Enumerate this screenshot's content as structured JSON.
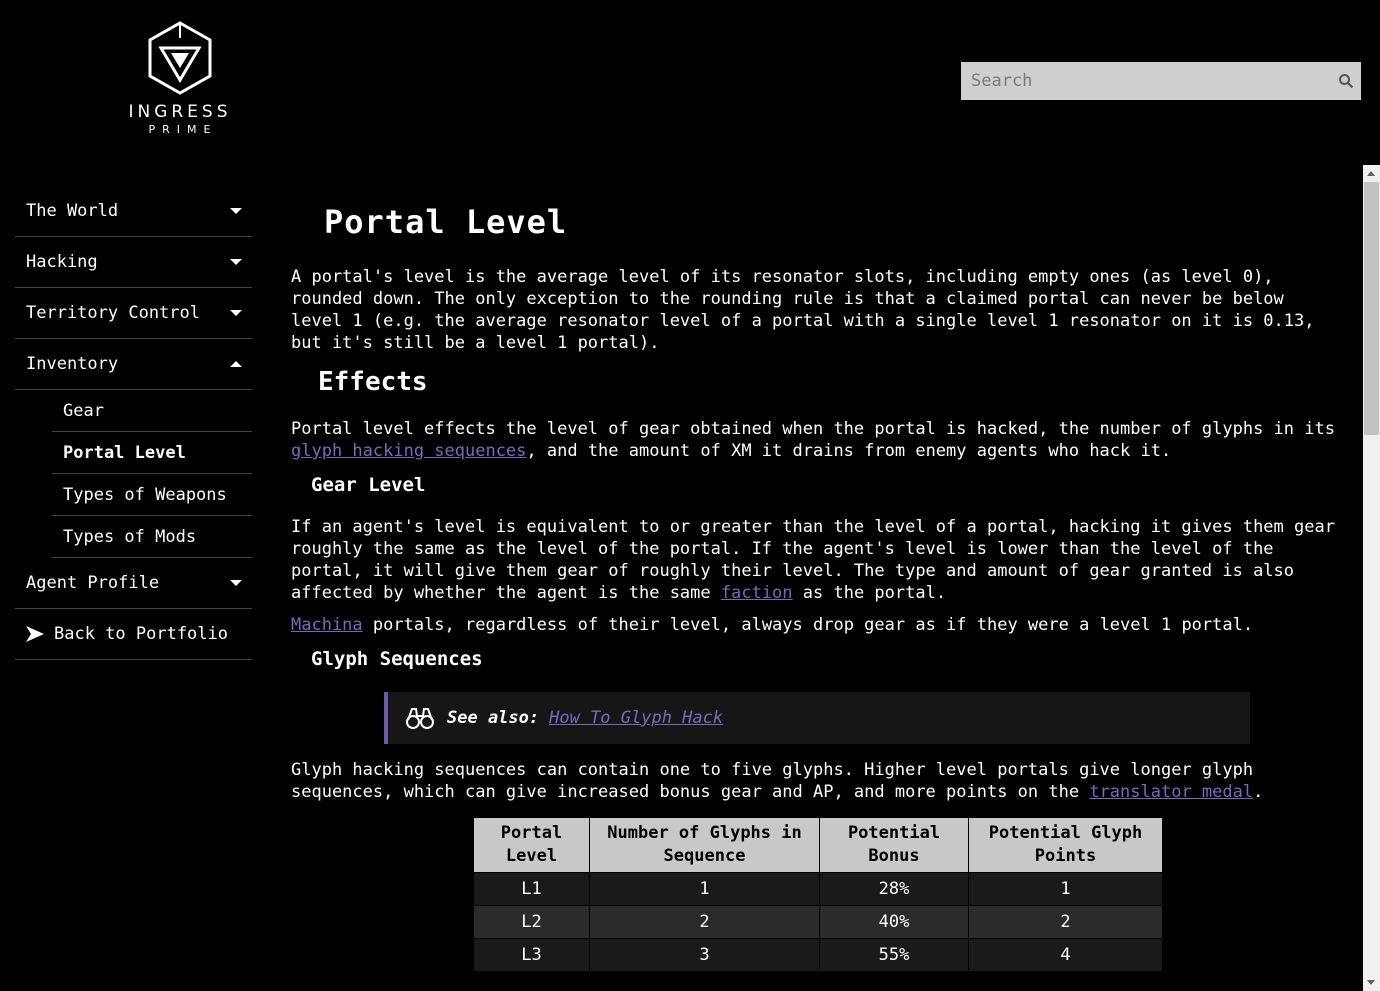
{
  "logo": {
    "word": "INGRESS",
    "sub": "PRIME"
  },
  "search": {
    "placeholder": "Search",
    "icon": "search-icon"
  },
  "sidebar": {
    "items": [
      {
        "label": "The World",
        "state": "collapsed"
      },
      {
        "label": "Hacking",
        "state": "collapsed"
      },
      {
        "label": "Territory Control",
        "state": "collapsed"
      },
      {
        "label": "Inventory",
        "state": "expanded",
        "children": [
          "Gear",
          "Portal Level",
          "Types of Weapons",
          "Types of Mods"
        ],
        "active_child": "Portal Level"
      },
      {
        "label": "Agent Profile",
        "state": "collapsed"
      }
    ],
    "back": {
      "icon": "arrow-right-icon",
      "label": "Back to Portfolio"
    }
  },
  "article": {
    "title": "Portal Level",
    "intro": "A portal's level is the average level of its resonator slots, including empty ones (as level 0), rounded down. The only exception to the rounding rule is that a claimed portal can never be below level 1 (e.g. the average resonator level of a portal with a single level 1 resonator on it is 0.13, but it's still be a level 1 portal).",
    "effects_heading": "Effects",
    "effects_p1_before": "Portal level effects the level of gear obtained when the portal is hacked, the number of glyphs in its ",
    "effects_p1_link": "glyph hacking sequences",
    "effects_p1_after": ", and the amount of XM it drains from enemy agents who hack it.",
    "gear_heading": "Gear Level",
    "gear_p1_before": "If an agent's level is equivalent to or greater than the level of a portal, hacking it gives them gear roughly the same as the level of the portal. If the agent's level is lower than the level of the portal, it will give them gear of roughly their level. The type and amount of gear granted is also affected by whether the agent is the same ",
    "gear_p1_link": "faction",
    "gear_p1_after": " as the portal.",
    "gear_p2_link": "Machina",
    "gear_p2_after": " portals, regardless of their level, always drop gear as if they were a level 1 portal.",
    "glyph_heading": "Glyph Sequences",
    "callout": {
      "icon": "binoculars-icon",
      "label": "See also:",
      "link": "How To Glyph Hack"
    },
    "glyph_p1_before": "Glyph hacking sequences can contain one to five glyphs. Higher level portals give longer glyph sequences, which can give increased bonus gear and AP, and more points on the ",
    "glyph_p1_link": "translator medal",
    "glyph_p1_after": ".",
    "table": {
      "headers": [
        "Portal Level",
        "Number of Glyphs in Sequence",
        "Potential Bonus",
        "Potential Glyph Points"
      ],
      "rows": [
        [
          "L1",
          "1",
          "28%",
          "1"
        ],
        [
          "L2",
          "2",
          "40%",
          "2"
        ],
        [
          "L3",
          "3",
          "55%",
          "4"
        ]
      ]
    }
  },
  "colors": {
    "link": "#7b68b8",
    "callout_accent": "#6c5aa8",
    "background": "#000000"
  }
}
